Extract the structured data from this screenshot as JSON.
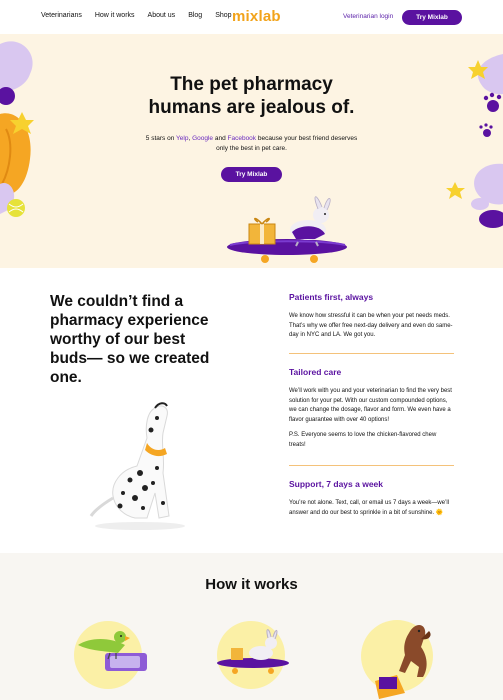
{
  "header": {
    "nav": [
      "Veterinarians",
      "How it works",
      "About us",
      "Blog",
      "Shop"
    ],
    "logo": "mixlab",
    "vet_login": "Veterinarian login",
    "try_button": "Try Mixlab"
  },
  "hero": {
    "title_line1": "The pet pharmacy",
    "title_line2": "humans are jealous of.",
    "sub_prefix": "5 stars on ",
    "sub_yelp": "Yelp",
    "sub_comma": ", ",
    "sub_google": "Google",
    "sub_and": " and ",
    "sub_facebook": "Facebook",
    "sub_suffix": " because your best friend deserves only the best in pet care.",
    "try_button": "Try Mixlab"
  },
  "mission": {
    "title": "We couldn’t find a pharmacy experience worthy of our best buds— so we created one.",
    "features": [
      {
        "title": "Patients first, always",
        "paragraphs": [
          "We know how stressful it can be when your pet needs meds. That’s why we offer free next-day delivery and even do same-day in NYC and LA. We got you."
        ]
      },
      {
        "title": "Tailored care",
        "paragraphs": [
          "We’ll work with you and your veterinarian to find the very best solution for your pet. With our custom compounded options, we can change the dosage, flavor and form. We even have a flavor guarantee with over 40 options!",
          "P.S. Everyone seems to love the chicken-flavored chew treats!"
        ]
      },
      {
        "title": "Support, 7 days a week",
        "paragraphs": [
          "You’re not alone. Text, call, or email us 7 days a week—we’ll answer and do our best to sprinkle in a bit of sunshine. 🌞"
        ]
      }
    ]
  },
  "how": {
    "title": "How it works"
  },
  "colors": {
    "brand_purple": "#5a12a0",
    "logo_orange": "#f2a31a",
    "hero_bg": "#fdf4e3"
  }
}
